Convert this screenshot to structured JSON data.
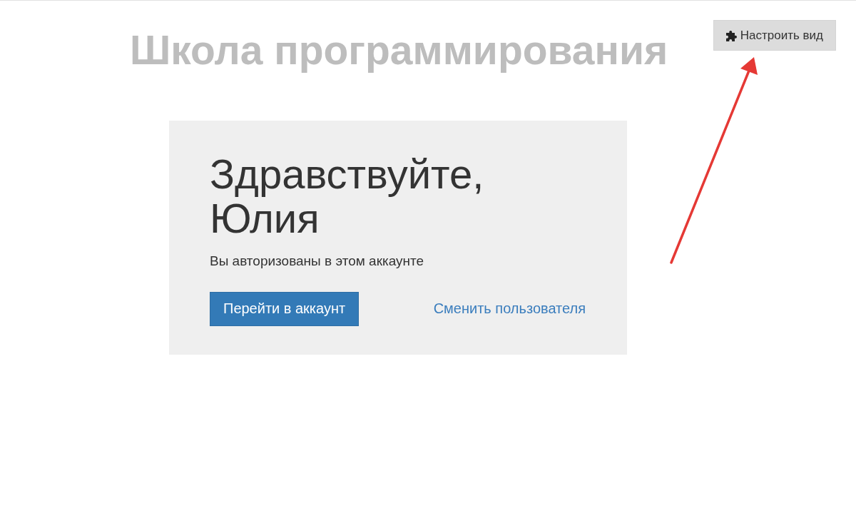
{
  "header": {
    "title": "Школа программирования",
    "customize_button": {
      "label": "Настроить вид"
    }
  },
  "login_card": {
    "heading": "Здравствуйте, Юлия",
    "subtitle": "Вы авторизованы в этом аккаунте",
    "primary_button": {
      "label": "Перейти в аккаунт"
    },
    "switch_link": {
      "label": "Сменить пользователя"
    }
  },
  "annotations": [
    {
      "kind": "arrow"
    }
  ]
}
